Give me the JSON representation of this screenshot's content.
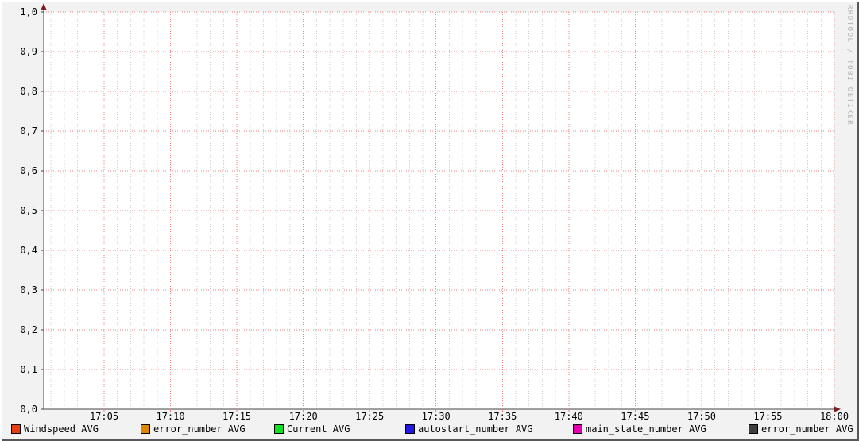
{
  "watermark": "RRDTOOL / TOBI OETIKER",
  "chart_data": {
    "type": "line",
    "title": "",
    "empty_plot": true,
    "legend_position": "bottom",
    "x": {
      "tick_labels": [
        "17:05",
        "17:10",
        "17:15",
        "17:20",
        "17:25",
        "17:30",
        "17:35",
        "17:40",
        "17:45",
        "17:50",
        "17:55",
        "18:00"
      ],
      "minor_ticks_per_major": 5
    },
    "y": {
      "min": 0.0,
      "max": 1.0,
      "step": 0.1,
      "tick_labels": [
        "0,0",
        "0,1",
        "0,2",
        "0,3",
        "0,4",
        "0,5",
        "0,6",
        "0,7",
        "0,8",
        "0,9",
        "1,0"
      ]
    },
    "grid": {
      "canvas": "#FFFFFF",
      "background": "#F2F2F2",
      "major_grid": "#EE8181",
      "minor_grid": "#CDCDCD",
      "axis": "#464646",
      "arrow": "#7D2020",
      "text": "#000000"
    },
    "series": [
      {
        "name": "Windspeed AVG",
        "color": "#E5400E",
        "values": []
      },
      {
        "name": "error_number AVG",
        "color": "#E08500",
        "values": []
      },
      {
        "name": "Current AVG",
        "color": "#10E020",
        "values": []
      },
      {
        "name": "autostart_number AVG",
        "color": "#2517E3",
        "values": []
      },
      {
        "name": "main_state_number AVG",
        "color": "#E500AE",
        "values": []
      },
      {
        "name": "error_number AVG",
        "color": "#3F3F3F",
        "values": []
      }
    ]
  }
}
